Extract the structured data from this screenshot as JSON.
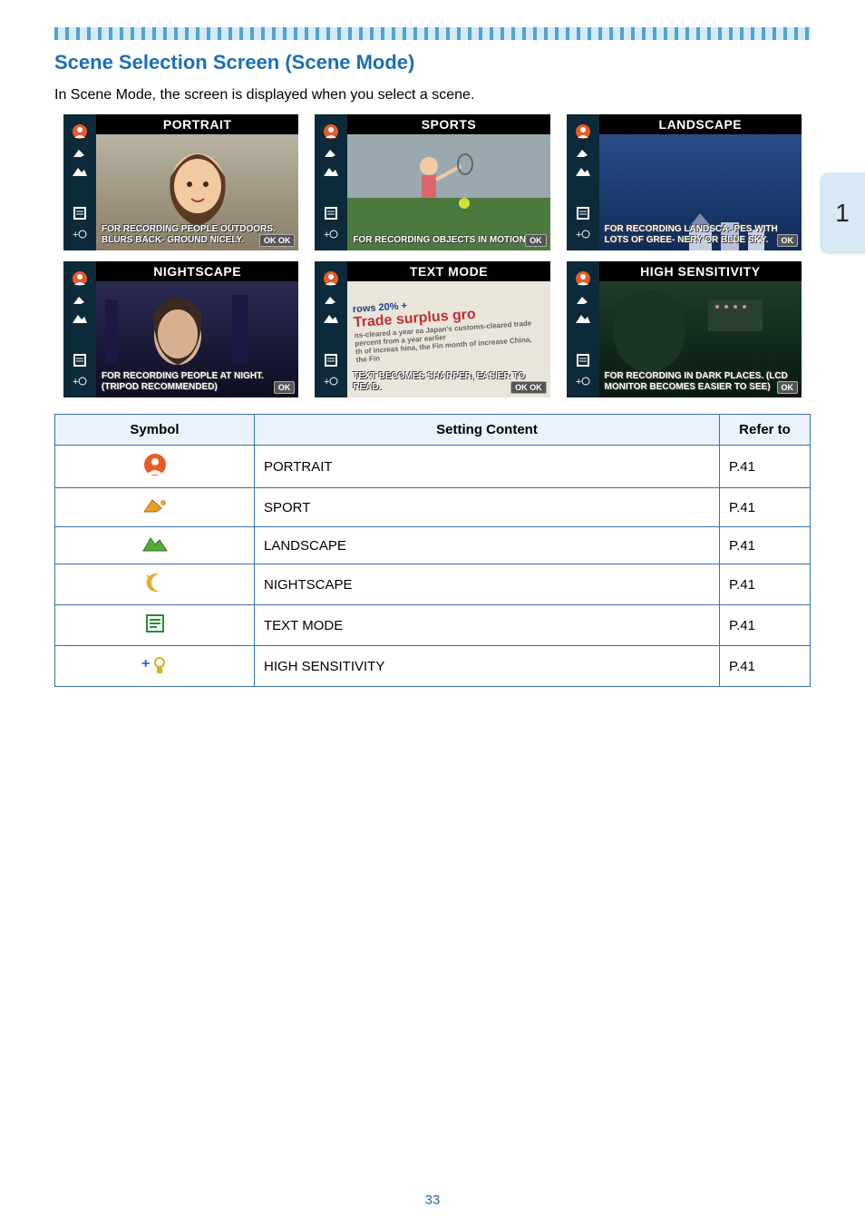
{
  "section_title": "Scene Selection Screen (Scene Mode)",
  "intro": "In Scene Mode, the screen is displayed when you select a scene.",
  "side_tab": "1",
  "scenes": [
    {
      "title": "PORTRAIT",
      "desc": "FOR RECORDING PEOPLE OUTDOORS. BLURS BACK- GROUND NICELY.",
      "ok": "OK OK"
    },
    {
      "title": "SPORTS",
      "desc": "FOR RECORDING OBJECTS IN MOTION.",
      "ok": "OK"
    },
    {
      "title": "LANDSCAPE",
      "desc": "FOR RECORDING LANDSCA- PES WITH LOTS OF GREE- NERY OR BLUE SKY.",
      "ok": "OK"
    },
    {
      "title": "NIGHTSCAPE",
      "desc": "FOR RECORDING PEOPLE AT NIGHT. (TRIPOD RECOMMENDED)",
      "ok": "OK"
    },
    {
      "title": "TEXT MODE",
      "desc": "TEXT BECOMES SHARPER, EASIER TO READ.",
      "ok": "OK OK"
    },
    {
      "title": "HIGH SENSITIVITY",
      "desc": "FOR RECORDING IN DARK PLACES. (LCD MONITOR BECOMES EASIER TO SEE)",
      "ok": "OK"
    }
  ],
  "text_mode_body": {
    "line1": "rows 20% +",
    "line2": "Trade surplus gro",
    "line3": "ns-cleared a year ea Japan's customs-cleared trade percent from a year earlier",
    "line4": "th of increas hina, the Fin month of increase China, the Fin"
  },
  "table": {
    "headers": {
      "symbol": "Symbol",
      "setting": "Setting Content",
      "refer": "Refer to"
    },
    "rows": [
      {
        "setting": "PORTRAIT",
        "refer": "P.41"
      },
      {
        "setting": "SPORT",
        "refer": "P.41"
      },
      {
        "setting": "LANDSCAPE",
        "refer": "P.41"
      },
      {
        "setting": "NIGHTSCAPE",
        "refer": "P.41"
      },
      {
        "setting": "TEXT MODE",
        "refer": "P.41"
      },
      {
        "setting": "HIGH SENSITIVITY",
        "refer": "P.41"
      }
    ]
  },
  "page_number": "33",
  "icons": {
    "portrait": "portrait-icon",
    "sport": "sport-icon",
    "landscape": "landscape-icon",
    "nightscape": "nightscape-icon",
    "textmode": "textmode-icon",
    "high": "high-sensitivity-icon"
  }
}
